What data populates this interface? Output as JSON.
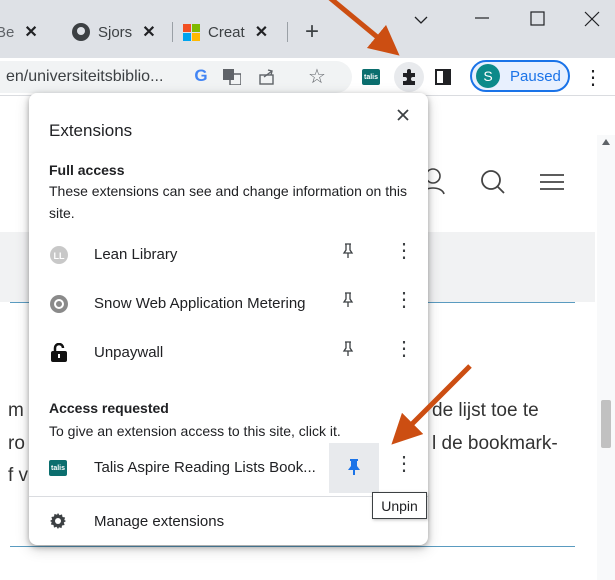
{
  "tabs": [
    {
      "label": "Be",
      "close": "✕"
    },
    {
      "label": "Sjors",
      "close": "✕"
    },
    {
      "label": "Creat",
      "close": "✕"
    }
  ],
  "new_tab": "+",
  "address": {
    "url": "en/universiteitsbiblio..."
  },
  "profile": {
    "initial": "S",
    "status": "Paused"
  },
  "page": {
    "text_lines": [
      "m",
      "ro",
      "f v"
    ],
    "right_text": [
      "de lijst toe te",
      "l de bookmark-"
    ]
  },
  "popup": {
    "title": "Extensions",
    "full_access_title": "Full access",
    "full_access_desc": "These extensions can see and change information on this site.",
    "full_access_items": [
      {
        "name": "Lean Library",
        "icon": "lean-library-icon"
      },
      {
        "name": "Snow Web Application Metering",
        "icon": "snow-gear-icon"
      },
      {
        "name": "Unpaywall",
        "icon": "unpaywall-lock-icon"
      }
    ],
    "requested_title": "Access requested",
    "requested_desc": "To give an extension access to this site, click it.",
    "requested_items": [
      {
        "name": "Talis Aspire Reading Lists Book...",
        "icon_text": "talis"
      }
    ],
    "manage": "Manage extensions"
  },
  "tooltip": "Unpin",
  "colors": {
    "accent": "#1a73e8",
    "arrow": "#cc4e12",
    "talis": "#0b6e6e"
  }
}
